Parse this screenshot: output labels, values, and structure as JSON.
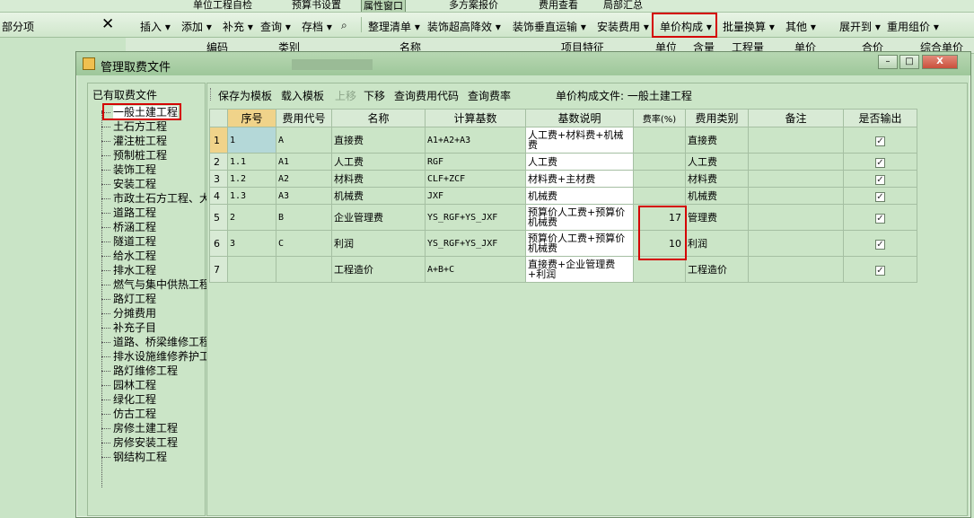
{
  "top_toolbar": {
    "items": [
      "单位工程自检",
      "预算书设置",
      "属性窗口",
      "多方案报价",
      "费用查看",
      "局部汇总"
    ]
  },
  "second_toolbar": {
    "left_label": "部分项",
    "close_symbol": "✕",
    "items": [
      "插入",
      "添加",
      "补充",
      "查询",
      "存档",
      "整理清单",
      "装饰超高降效",
      "装饰垂直运输",
      "安装费用",
      "单价构成",
      "批量换算",
      "其他",
      "展开到",
      "重用组价"
    ]
  },
  "bg_grid_headers": [
    "编码",
    "类别",
    "名称",
    "项目特征",
    "单位",
    "含量",
    "工程量",
    "单价",
    "合价",
    "综合单价"
  ],
  "dialog": {
    "title": "管理取费文件",
    "buttons": {
      "minimize": "–",
      "maximize": "□",
      "close": "X"
    },
    "tree": {
      "title": "已有取费文件",
      "items": [
        "一般土建工程",
        "土石方工程",
        "灌注桩工程",
        "预制桩工程",
        "装饰工程",
        "安装工程",
        "市政土石方工程、大",
        "道路工程",
        "桥涵工程",
        "隧道工程",
        "给水工程",
        "排水工程",
        "燃气与集中供热工程",
        "路灯工程",
        "分摊费用",
        "补充子目",
        "道路、桥梁维修工程",
        "排水设施维修养护工",
        "路灯维修工程",
        "园林工程",
        "绿化工程",
        "仿古工程",
        "房修土建工程",
        "房修安装工程",
        "钢结构工程"
      ],
      "selected": "一般土建工程"
    },
    "toolbar": {
      "save_template": "保存为模板",
      "load_template": "载入模板",
      "move_up": "上移",
      "move_down": "下移",
      "query_code": "查询费用代码",
      "query_rate": "查询费率",
      "file_label": "单价构成文件: 一般土建工程"
    },
    "table": {
      "headers": [
        "",
        "序号",
        "费用代号",
        "名称",
        "计算基数",
        "基数说明",
        "费率(%)",
        "费用类别",
        "备注",
        "是否输出"
      ],
      "rows": [
        {
          "idx": "1",
          "seq": "1",
          "code": "A",
          "name": "直接费",
          "base": "A1+A2+A3",
          "desc": "人工费+材料费+机械费",
          "rate": "",
          "category": "直接费",
          "remark": "",
          "output": true
        },
        {
          "idx": "2",
          "seq": "1.1",
          "code": "A1",
          "name": "人工费",
          "base": "RGF",
          "desc": "人工费",
          "rate": "",
          "category": "人工费",
          "remark": "",
          "output": true
        },
        {
          "idx": "3",
          "seq": "1.2",
          "code": "A2",
          "name": "材料费",
          "base": "CLF+ZCF",
          "desc": "材料费+主材费",
          "rate": "",
          "category": "材料费",
          "remark": "",
          "output": true
        },
        {
          "idx": "4",
          "seq": "1.3",
          "code": "A3",
          "name": "机械费",
          "base": "JXF",
          "desc": "机械费",
          "rate": "",
          "category": "机械费",
          "remark": "",
          "output": true
        },
        {
          "idx": "5",
          "seq": "2",
          "code": "B",
          "name": "企业管理费",
          "base": "YS_RGF+YS_JXF",
          "desc": "预算价人工费+预算价机械费",
          "rate": "17",
          "category": "管理费",
          "remark": "",
          "output": true
        },
        {
          "idx": "6",
          "seq": "3",
          "code": "C",
          "name": "利润",
          "base": "YS_RGF+YS_JXF",
          "desc": "预算价人工费+预算价机械费",
          "rate": "10",
          "category": "利润",
          "remark": "",
          "output": true
        },
        {
          "idx": "7",
          "seq": "",
          "code": "",
          "name": "工程造价",
          "base": "A+B+C",
          "desc": "直接费+企业管理费+利润",
          "rate": "",
          "category": "工程造价",
          "remark": "",
          "output": true
        }
      ]
    }
  },
  "colors": {
    "highlight_red": "#d40000",
    "panel_green": "#c9e4c6"
  }
}
